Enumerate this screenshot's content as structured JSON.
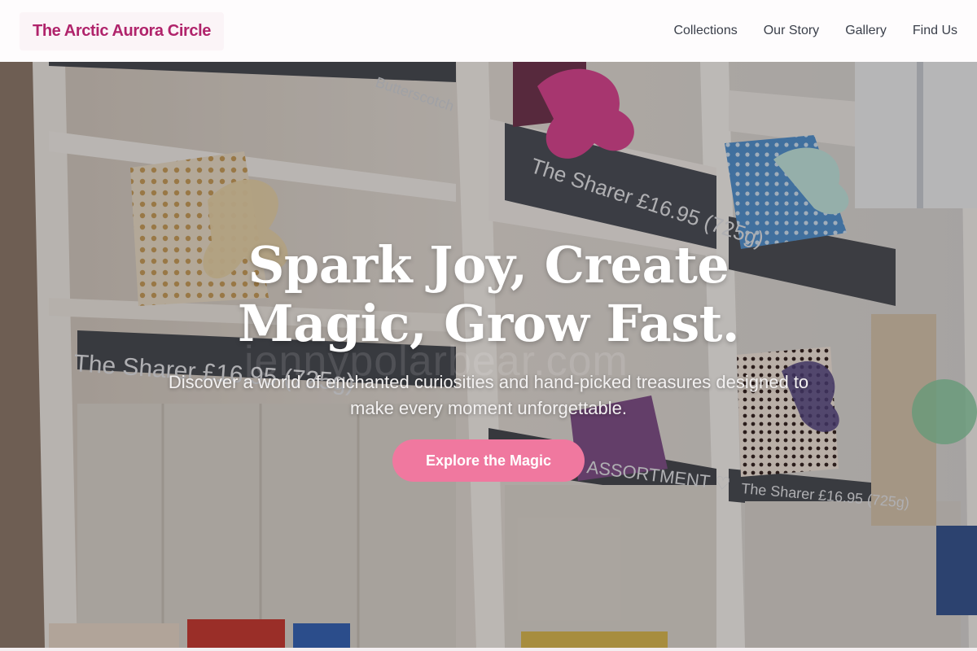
{
  "header": {
    "brand": "The Arctic Aurora Circle",
    "nav": [
      {
        "label": "Collections"
      },
      {
        "label": "Our Story"
      },
      {
        "label": "Gallery"
      },
      {
        "label": "Find Us"
      }
    ]
  },
  "hero": {
    "title": "Spark Joy, Create Magic, Grow Fast.",
    "subtitle": "Discover a world of enchanted curiosities and hand-picked treasures designed to make every moment unforgettable.",
    "cta_label": "Explore the Magic",
    "watermark": "jennypolarbear.com",
    "background_image": "gift-shop-shelves-photo",
    "shelf_labels": [
      "Butterscotch",
      "The Sharer £16.95 (725g)",
      "The Sharer £16.95 (725g)",
      "ASSORTMENT ♡",
      "The Sharer £16.95 (725g)"
    ]
  },
  "colors": {
    "brand": "#b0236b",
    "cta": "#f0789f",
    "nav_text": "#3a3f4a"
  }
}
